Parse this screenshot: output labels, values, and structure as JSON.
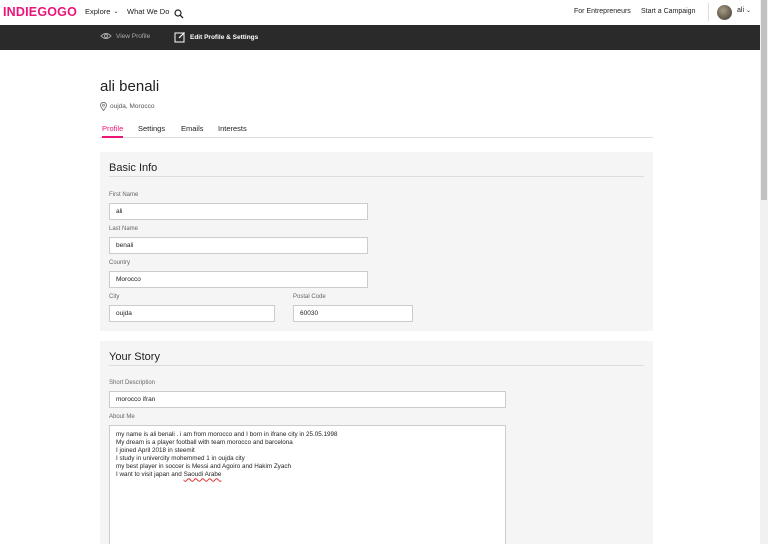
{
  "nav": {
    "logo": "INDIEGOGO",
    "explore": "Explore",
    "what_we_do": "What We Do",
    "for_entrepreneurs": "For Entrepreneurs",
    "start_campaign": "Start a Campaign",
    "user": "ali"
  },
  "subnav": {
    "view_profile": "View Profile",
    "edit_profile": "Edit Profile & Settings"
  },
  "profile": {
    "name": "ali benali",
    "location": "oujda, Morocco"
  },
  "tabs": [
    {
      "label": "Profile"
    },
    {
      "label": "Settings"
    },
    {
      "label": "Emails"
    },
    {
      "label": "Interests"
    }
  ],
  "basic_info": {
    "title": "Basic Info",
    "first_name": {
      "label": "First Name",
      "value": "ali"
    },
    "last_name": {
      "label": "Last Name",
      "value": "benali"
    },
    "country": {
      "label": "Country",
      "value": "Morocco"
    },
    "city": {
      "label": "City",
      "value": "oujda"
    },
    "postal_code": {
      "label": "Postal Code",
      "value": "60030"
    }
  },
  "your_story": {
    "title": "Your Story",
    "short_description": {
      "label": "Short Description",
      "value": "morocco ifran"
    },
    "about_me": {
      "label": "About Me",
      "lines": [
        "my name is ali benali . i am from morocco and I born in ifrane city in 25.05.1998",
        "My dream is a player football with team morocco and barcelona",
        "I joined April 2018 in steemit",
        "I study in univercity mohemmed 1 in oujda city",
        "my best player in soccer is Messi and Agoiro and Hakim Zyach",
        "I want to visit japan and "
      ],
      "last_line_flagged": "Saoudi Arabe"
    }
  },
  "colors": {
    "brand": "#eb1478",
    "subnav_bg": "#2a2a2a",
    "card_bg": "#f5f5f5"
  }
}
